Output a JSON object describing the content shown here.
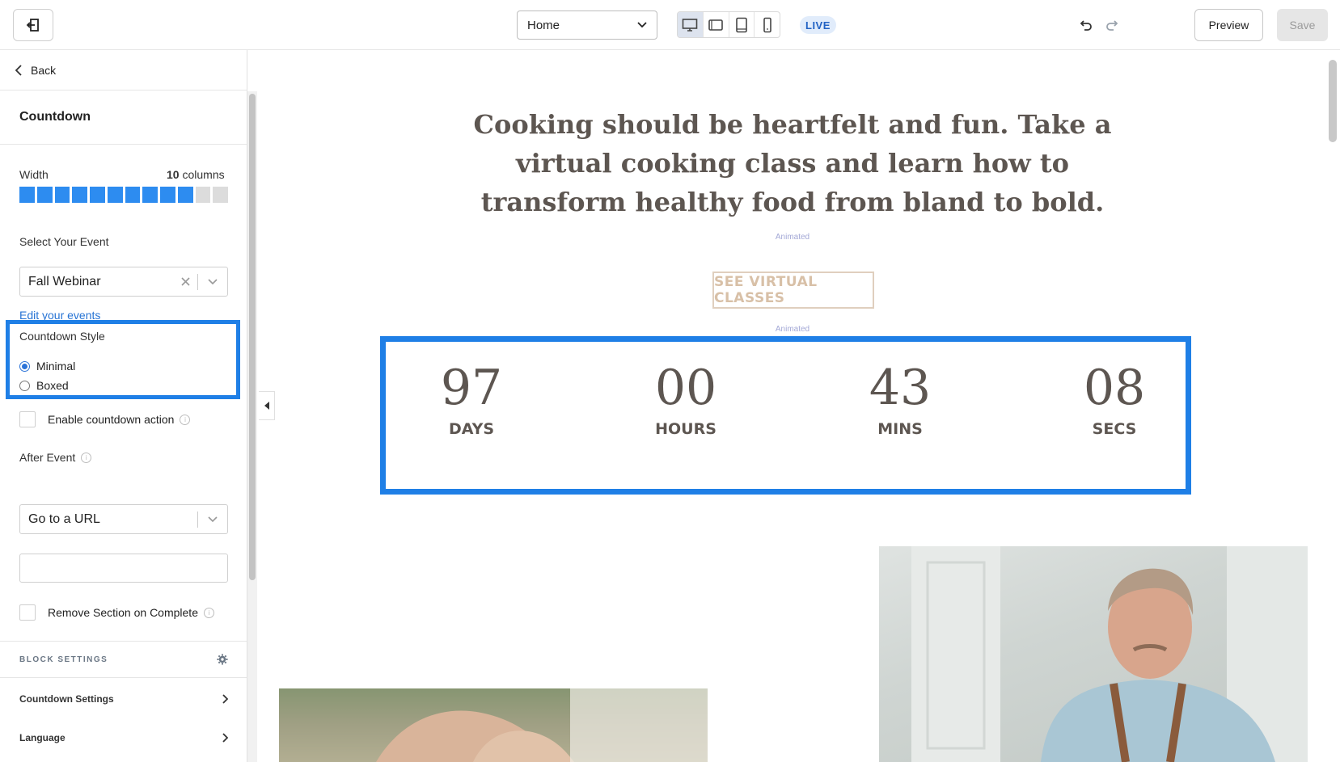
{
  "topbar": {
    "page_select_value": "Home",
    "live_label": "LIVE",
    "preview_label": "Preview",
    "save_label": "Save"
  },
  "panel": {
    "back_label": "Back",
    "section_title": "Countdown",
    "width_label": "Width",
    "width_value": "10",
    "width_unit": "columns",
    "width_total_columns": 12,
    "select_event_label": "Select Your Event",
    "event_value": "Fall Webinar",
    "edit_events_link": "Edit your events",
    "countdown_style_label": "Countdown Style",
    "style_options": [
      "Minimal",
      "Boxed"
    ],
    "style_selected": "Minimal",
    "enable_action_label": "Enable countdown action",
    "after_event_label": "After Event",
    "after_event_value": "Go to a URL",
    "url_value": "",
    "remove_section_label": "Remove Section on Complete",
    "block_settings_label": "BLOCK SETTINGS",
    "accordions": [
      "Countdown Settings",
      "Language"
    ]
  },
  "canvas": {
    "headline": "Cooking should be heartfelt and fun. Take a virtual cooking class and learn how to transform healthy food from bland to bold.",
    "animated_label": "Animated",
    "cta_label": "SEE VIRTUAL CLASSES",
    "countdown": [
      {
        "value": "97",
        "label": "DAYS"
      },
      {
        "value": "00",
        "label": "HOURS"
      },
      {
        "value": "43",
        "label": "MINS"
      },
      {
        "value": "08",
        "label": "SECS"
      }
    ]
  },
  "colors": {
    "accent": "#1f7fe6",
    "heading": "#5d5651",
    "cta_border": "#e0cfbe"
  }
}
